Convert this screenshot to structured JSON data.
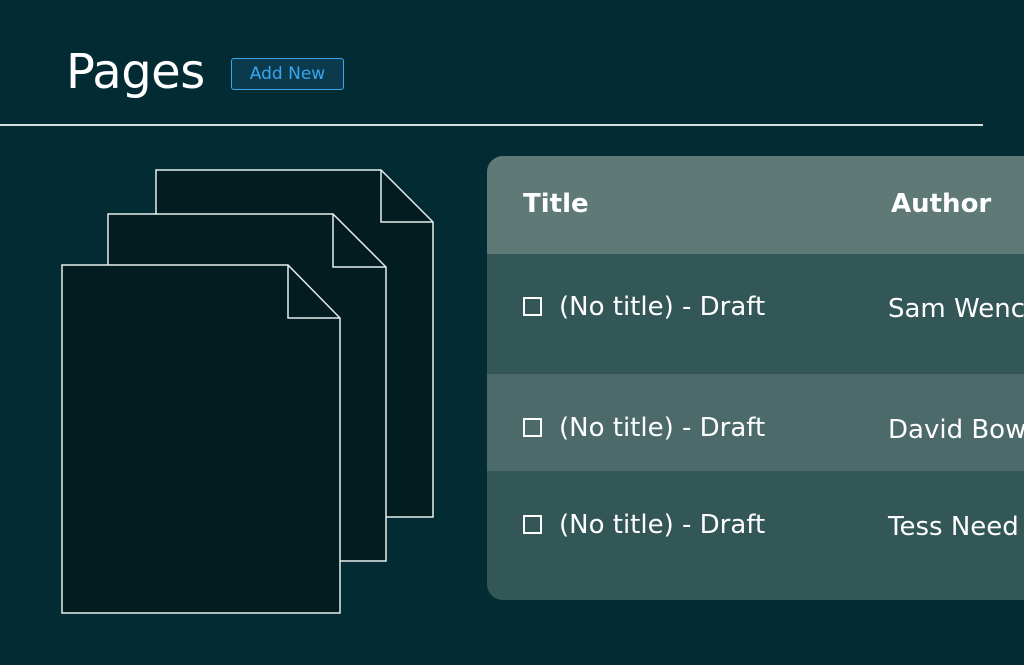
{
  "header": {
    "title": "Pages",
    "add_new_label": "Add New"
  },
  "table": {
    "columns": [
      "Title",
      "Author"
    ],
    "rows": [
      {
        "title": "(No title) - Draft",
        "author": "Sam Wenc"
      },
      {
        "title": "(No title) - Draft",
        "author": "David Bow"
      },
      {
        "title": "(No title) - Draft",
        "author": "Tess Need"
      }
    ]
  },
  "illustration": {
    "icon": "stacked-documents-icon"
  },
  "colors": {
    "background": "#032b33",
    "accent": "#3aa6f0",
    "table_header": "#5f7977",
    "row": "#335756",
    "row_alt": "#4b6a69",
    "document_fill": "#021c20"
  }
}
